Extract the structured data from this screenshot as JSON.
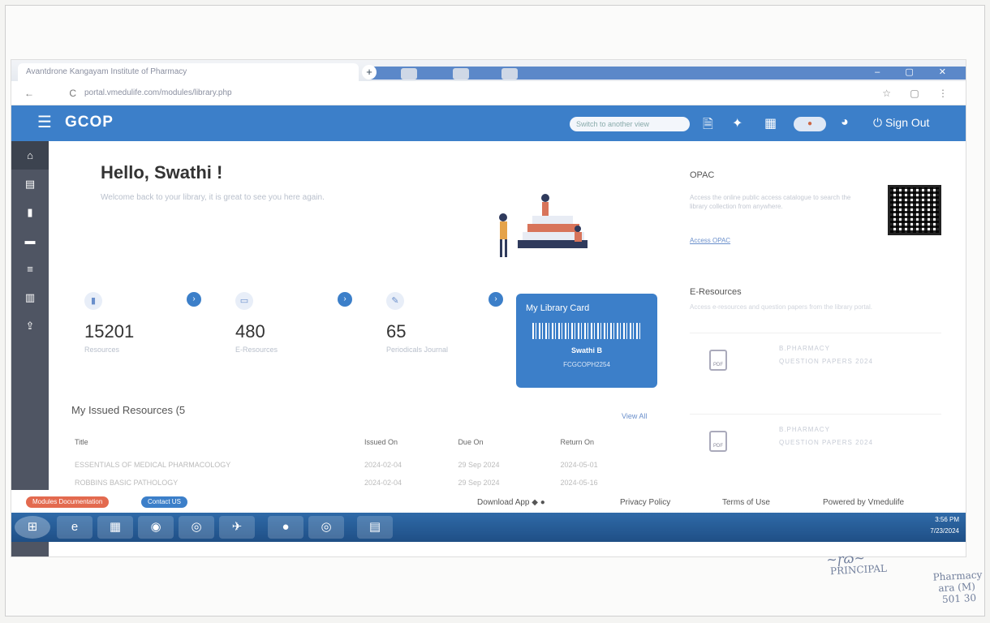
{
  "browser": {
    "tab_title": "Avantdrone Kangayam Institute of Pharmacy",
    "url": "portal.vmedulife.com/modules/library.php",
    "new_tab": "+",
    "window_controls": "– ▢ ✕",
    "nav_symbols": "← C",
    "right_symbols": "☆ ▢ ⋮"
  },
  "header": {
    "brand": "GCOP",
    "switch_placeholder": "Switch to another view",
    "sign_out": "Sign Out"
  },
  "sidebar": {
    "icons": [
      "university-icon",
      "document-icon",
      "file-icon",
      "card-icon",
      "list-icon",
      "book-icon",
      "upload-icon"
    ]
  },
  "greeting": {
    "title": "Hello, Swathi !",
    "subtitle": "Welcome back to your library, it is great to see you here again."
  },
  "stats": [
    {
      "value": "15201",
      "label": "Resources"
    },
    {
      "value": "480",
      "label": "E-Resources"
    },
    {
      "value": "65",
      "label": "Periodicals Journal"
    }
  ],
  "library_card": {
    "title": "My Library Card",
    "name": "Swathi B",
    "id": "FCGCOPH2254"
  },
  "issued": {
    "title": "My Issued Resources (5",
    "view_all": "View All",
    "columns": [
      "Title",
      "Issued On",
      "Due On",
      "Return On"
    ],
    "rows": [
      [
        "ESSENTIALS OF MEDICAL PHARMACOLOGY",
        "2024-02-04",
        "29 Sep 2024",
        "2024-05-01"
      ],
      [
        "ROBBINS BASIC PATHOLOGY",
        "2024-02-04",
        "29 Sep 2024",
        "2024-05-16"
      ]
    ]
  },
  "opac": {
    "title": "OPAC",
    "description": "Access the online public access catalogue to search the library collection from anywhere.",
    "link": "Access OPAC"
  },
  "eresources": {
    "title": "E-Resources",
    "subtitle": "Access e-resources and question papers from the library portal.",
    "items": [
      {
        "line1": "B.PHARMACY",
        "line2": "QUESTION PAPERS 2024"
      },
      {
        "line1": "B.PHARMACY",
        "line2": "QUESTION PAPERS 2024"
      }
    ]
  },
  "footer": {
    "badge_docs": "Modules Documentation",
    "badge_contact": "Contact US",
    "download": "Download App",
    "privacy": "Privacy Policy",
    "terms": "Terms of Use",
    "powered": "Powered by Vmedulife"
  },
  "taskbar": {
    "time": "3:56 PM",
    "date": "7/23/2024"
  },
  "stamp": {
    "line1": "PRINCIPAL",
    "line2": "Pharmacy",
    "line3": "ara (M)",
    "line4": "501 30"
  },
  "colors": {
    "brand_blue": "#3c7fc9",
    "sidebar": "#4f5563"
  }
}
